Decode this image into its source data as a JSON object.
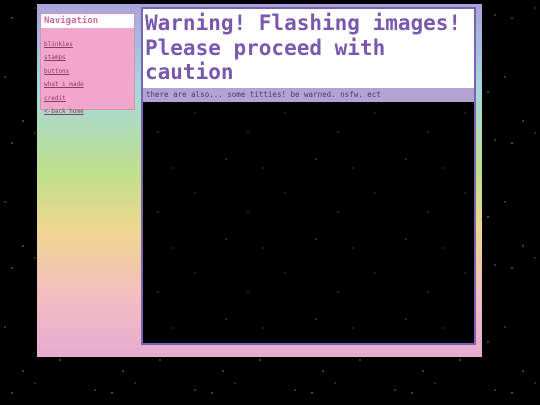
{
  "sidebar": {
    "title": "Navigation",
    "items": [
      {
        "label": "blinkies"
      },
      {
        "label": "stamps"
      },
      {
        "label": "buttons"
      },
      {
        "label": "what i made"
      },
      {
        "label": "credit"
      },
      {
        "label": "<-back home"
      }
    ]
  },
  "main": {
    "warning_text": "Warning! Flashing images! Please proceed with caution",
    "note_text": "there are also... some titties! be warned. nsfw. ect"
  },
  "colors": {
    "page_background": "#000000",
    "sidebar_background": "#f1a7cb",
    "sidebar_title": "#d06a9a",
    "link": "#8a3d62",
    "warning_text": "#7a58b0",
    "note_background": "#b3a3d2",
    "main_border": "#7a64b2"
  }
}
